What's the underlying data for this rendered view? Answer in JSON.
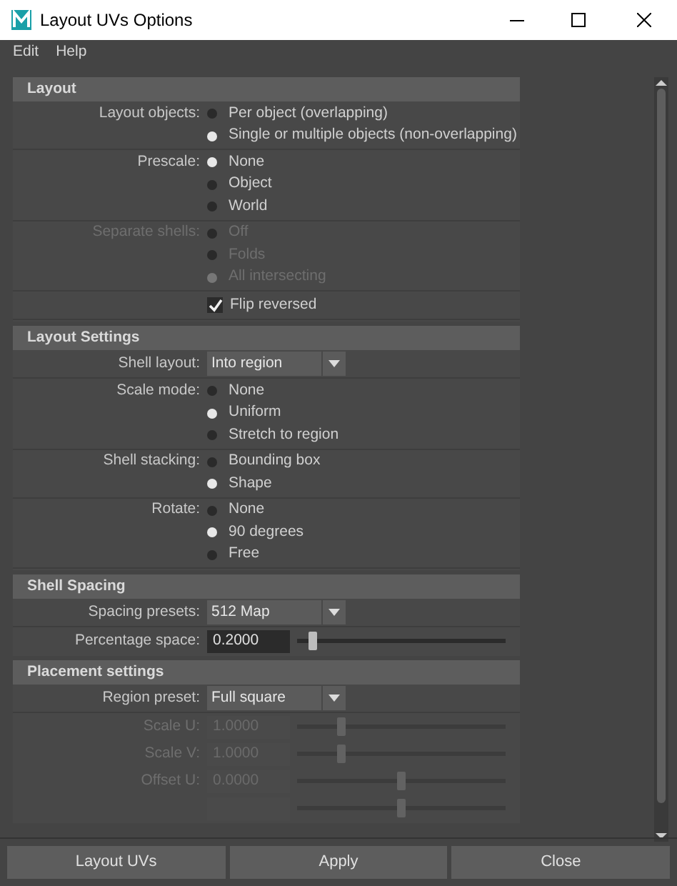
{
  "window": {
    "title": "Layout UVs Options"
  },
  "menu": [
    "Edit",
    "Help"
  ],
  "sections": [
    {
      "title": "Layout",
      "groups": [
        {
          "kind": "radio",
          "label": "Layout objects:",
          "disabled": false,
          "options": [
            {
              "label": "Per object (overlapping)",
              "selected": false
            },
            {
              "label": "Single or multiple objects (non-overlapping)",
              "selected": true
            }
          ]
        },
        {
          "kind": "radio",
          "label": "Prescale:",
          "disabled": false,
          "options": [
            {
              "label": "None",
              "selected": true
            },
            {
              "label": "Object",
              "selected": false
            },
            {
              "label": "World",
              "selected": false
            }
          ]
        },
        {
          "kind": "radio",
          "label": "Separate shells:",
          "disabled": true,
          "options": [
            {
              "label": "Off",
              "selected": false
            },
            {
              "label": "Folds",
              "selected": false
            },
            {
              "label": "All intersecting",
              "selected": true
            }
          ]
        },
        {
          "kind": "checkbox",
          "text": "Flip reversed",
          "checked": true,
          "disabled": false
        }
      ]
    },
    {
      "title": "Layout Settings",
      "groups": [
        {
          "kind": "dropdown",
          "label": "Shell layout:",
          "value": "Into region",
          "disabled": false
        },
        {
          "kind": "radio",
          "label": "Scale mode:",
          "disabled": false,
          "options": [
            {
              "label": "None",
              "selected": false
            },
            {
              "label": "Uniform",
              "selected": true
            },
            {
              "label": "Stretch to region",
              "selected": false
            }
          ]
        },
        {
          "kind": "radio",
          "label": "Shell stacking:",
          "disabled": false,
          "options": [
            {
              "label": "Bounding box",
              "selected": false
            },
            {
              "label": "Shape",
              "selected": true
            }
          ]
        },
        {
          "kind": "radio",
          "label": "Rotate:",
          "disabled": false,
          "options": [
            {
              "label": "None",
              "selected": false
            },
            {
              "label": "90 degrees",
              "selected": true
            },
            {
              "label": "Free",
              "selected": false
            }
          ]
        }
      ]
    },
    {
      "title": "Shell Spacing",
      "groups": [
        {
          "kind": "dropdown",
          "label": "Spacing presets:",
          "value": "512 Map",
          "disabled": false
        },
        {
          "kind": "slider",
          "label": "Percentage space:",
          "value": "0.2000",
          "level": 0.06,
          "disabled": false
        }
      ]
    },
    {
      "title": "Placement settings",
      "groups": [
        {
          "kind": "dropdown",
          "label": "Region preset:",
          "value": "Full square",
          "disabled": false
        },
        {
          "kind": "slider",
          "label": "Scale U:",
          "value": "1.0000",
          "level": 0.2,
          "disabled": true
        },
        {
          "kind": "slider",
          "label": "Scale V:",
          "value": "1.0000",
          "level": 0.2,
          "disabled": true
        },
        {
          "kind": "slider",
          "label": "Offset U:",
          "value": "0.0000",
          "level": 0.5,
          "disabled": true
        },
        {
          "kind": "slider",
          "level": 0.5,
          "disabled": true
        }
      ]
    }
  ],
  "buttons": [
    "Layout UVs",
    "Apply",
    "Close"
  ]
}
